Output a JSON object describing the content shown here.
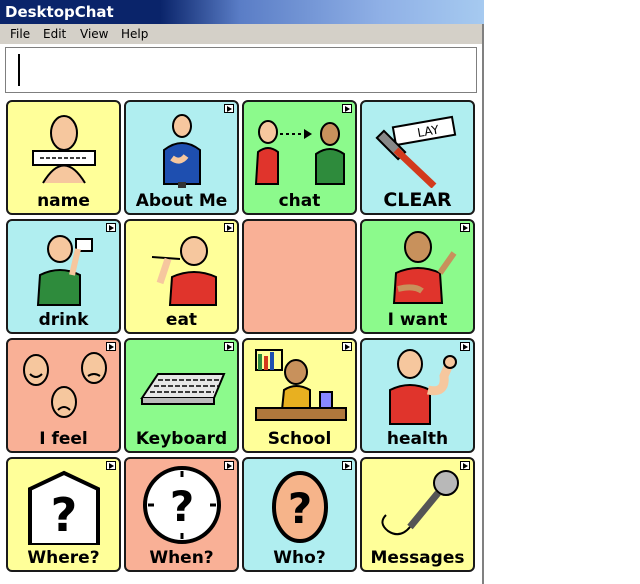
{
  "window": {
    "title": "DesktopChat"
  },
  "menu": [
    "File",
    "Edit",
    "View",
    "Help"
  ],
  "message_box": {
    "value": ""
  },
  "colors": {
    "yellow": "#ffff99",
    "cyan": "#b0eef0",
    "green": "#8cfa8c",
    "peach": "#f9b096"
  },
  "tiles": [
    {
      "label": "name",
      "color": "#ffff99",
      "icon": "name-tag-person-icon",
      "has_folder": false
    },
    {
      "label": "About Me",
      "color": "#b0eef0",
      "icon": "person-pointing-self-icon",
      "has_folder": true
    },
    {
      "label": "chat",
      "color": "#8cfa8c",
      "icon": "two-people-talking-icon",
      "has_folder": true
    },
    {
      "label": "CLEAR",
      "color": "#b0eef0",
      "icon": "squeegee-display-icon",
      "has_folder": false
    },
    {
      "label": "drink",
      "color": "#b0eef0",
      "icon": "person-drinking-icon",
      "has_folder": true
    },
    {
      "label": "eat",
      "color": "#ffff99",
      "icon": "person-eating-icon",
      "has_folder": true
    },
    {
      "label": "",
      "color": "#f9b096",
      "icon": "empty-cell",
      "has_folder": false
    },
    {
      "label": "I want",
      "color": "#8cfa8c",
      "icon": "person-want-gesture-icon",
      "has_folder": true
    },
    {
      "label": "I feel",
      "color": "#f9b096",
      "icon": "feelings-faces-icon",
      "has_folder": true
    },
    {
      "label": "Keyboard",
      "color": "#8cfa8c",
      "icon": "keyboard-icon",
      "has_folder": true
    },
    {
      "label": "School",
      "color": "#ffff99",
      "icon": "student-at-desk-icon",
      "has_folder": true
    },
    {
      "label": "health",
      "color": "#b0eef0",
      "icon": "strong-arm-person-icon",
      "has_folder": true
    },
    {
      "label": "Where?",
      "color": "#ffff99",
      "icon": "house-question-icon",
      "has_folder": true
    },
    {
      "label": "When?",
      "color": "#f9b096",
      "icon": "clock-question-icon",
      "has_folder": true
    },
    {
      "label": "Who?",
      "color": "#b0eef0",
      "icon": "head-question-icon",
      "has_folder": true
    },
    {
      "label": "Messages",
      "color": "#ffff99",
      "icon": "microphone-icon",
      "has_folder": true
    }
  ]
}
